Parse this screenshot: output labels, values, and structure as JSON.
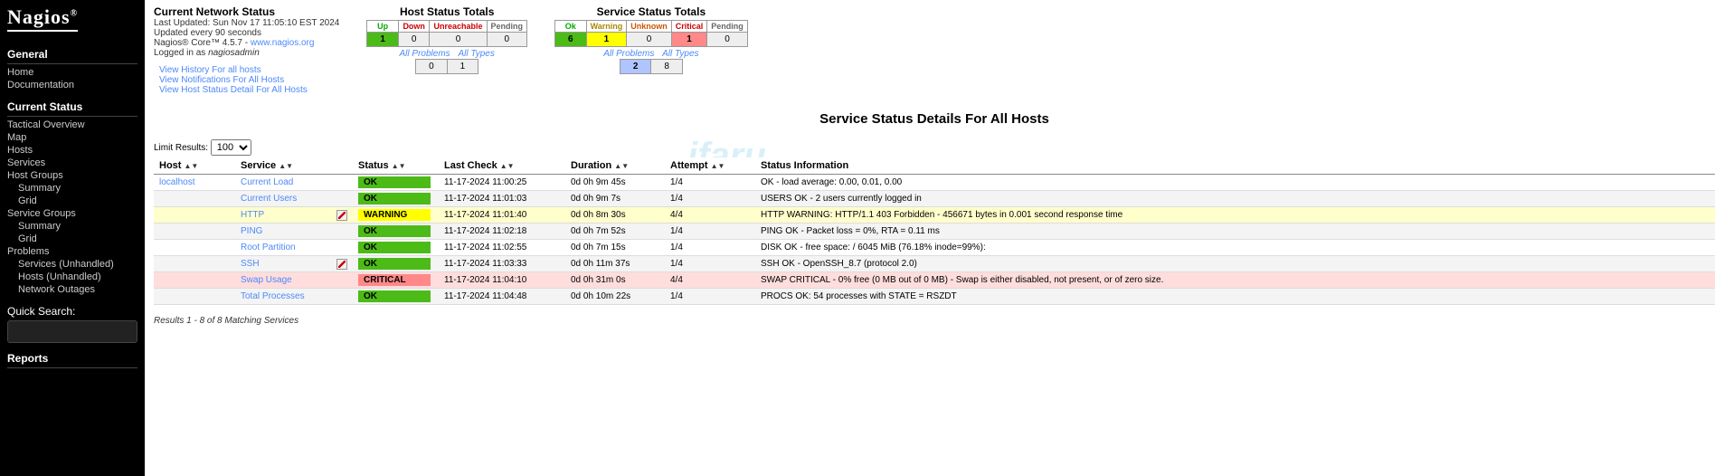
{
  "brand": "Nagios",
  "sidebar": {
    "sections": [
      {
        "title": "General",
        "items": [
          "Home",
          "Documentation"
        ]
      },
      {
        "title": "Current Status",
        "items": [
          "Tactical Overview",
          "Map",
          "Hosts",
          "Services",
          "Host Groups"
        ],
        "sub1": [
          "Summary",
          "Grid"
        ],
        "items2": [
          "Service Groups"
        ],
        "sub2": [
          "Summary",
          "Grid"
        ],
        "items3": [
          "Problems"
        ],
        "sub3": [
          "Services (Unhandled)",
          "Hosts (Unhandled)",
          "Network Outages"
        ]
      },
      {
        "title": "Reports",
        "items": []
      }
    ],
    "search_label": "Quick Search:"
  },
  "status_info": {
    "title": "Current Network Status",
    "last_updated": "Last Updated: Sun Nov 17 11:05:10 EST 2024",
    "updated_every": "Updated every 90 seconds",
    "core_prefix": "Nagios® Core™ 4.5.7 - ",
    "core_link": "www.nagios.org",
    "logged_in_prefix": "Logged in as ",
    "logged_in_user": "nagiosadmin",
    "links": [
      "View History For all hosts",
      "View Notifications For All Hosts",
      "View Host Status Detail For All Hosts"
    ]
  },
  "host_totals": {
    "title": "Host Status Totals",
    "headers": [
      "Up",
      "Down",
      "Unreachable",
      "Pending"
    ],
    "values": [
      "1",
      "0",
      "0",
      "0"
    ],
    "sub_labels": [
      "All Problems",
      "All Types"
    ],
    "sub_values": [
      "0",
      "1"
    ]
  },
  "service_totals": {
    "title": "Service Status Totals",
    "headers": [
      "Ok",
      "Warning",
      "Unknown",
      "Critical",
      "Pending"
    ],
    "values": [
      "6",
      "1",
      "0",
      "1",
      "0"
    ],
    "sub_labels": [
      "All Problems",
      "All Types"
    ],
    "sub_values": [
      "2",
      "8"
    ]
  },
  "page_heading": "Service Status Details For All Hosts",
  "limit": {
    "label": "Limit Results:",
    "value": "100"
  },
  "columns": [
    "Host",
    "Service",
    "Status",
    "Last Check",
    "Duration",
    "Attempt",
    "Status Information"
  ],
  "rows": [
    {
      "host": "localhost",
      "service": "Current Load",
      "status": "OK",
      "last_check": "11-17-2024 11:00:25",
      "duration": "0d 0h 9m 45s",
      "attempt": "1/4",
      "info": "OK - load average: 0.00, 0.01, 0.00",
      "notify_off": false,
      "row_class": ""
    },
    {
      "host": "",
      "service": "Current Users",
      "status": "OK",
      "last_check": "11-17-2024 11:01:03",
      "duration": "0d 0h 9m 7s",
      "attempt": "1/4",
      "info": "USERS OK - 2 users currently logged in",
      "notify_off": false,
      "row_class": "row-alt"
    },
    {
      "host": "",
      "service": "HTTP",
      "status": "WARNING",
      "last_check": "11-17-2024 11:01:40",
      "duration": "0d 0h 8m 30s",
      "attempt": "4/4",
      "info": "HTTP WARNING: HTTP/1.1 403 Forbidden - 456671 bytes in 0.001 second response time",
      "notify_off": true,
      "row_class": "row-warn"
    },
    {
      "host": "",
      "service": "PING",
      "status": "OK",
      "last_check": "11-17-2024 11:02:18",
      "duration": "0d 0h 7m 52s",
      "attempt": "1/4",
      "info": "PING OK - Packet loss = 0%, RTA = 0.11 ms",
      "notify_off": false,
      "row_class": "row-alt"
    },
    {
      "host": "",
      "service": "Root Partition",
      "status": "OK",
      "last_check": "11-17-2024 11:02:55",
      "duration": "0d 0h 7m 15s",
      "attempt": "1/4",
      "info": "DISK OK - free space: / 6045 MiB (76.18% inode=99%):",
      "notify_off": false,
      "row_class": ""
    },
    {
      "host": "",
      "service": "SSH",
      "status": "OK",
      "last_check": "11-17-2024 11:03:33",
      "duration": "0d 0h 11m 37s",
      "attempt": "1/4",
      "info": "SSH OK - OpenSSH_8.7 (protocol 2.0)",
      "notify_off": true,
      "row_class": "row-alt"
    },
    {
      "host": "",
      "service": "Swap Usage",
      "status": "CRITICAL",
      "last_check": "11-17-2024 11:04:10",
      "duration": "0d 0h 31m 0s",
      "attempt": "4/4",
      "info": "SWAP CRITICAL - 0% free (0 MB out of 0 MB) - Swap is either disabled, not present, or of zero size.",
      "notify_off": false,
      "row_class": "row-crit"
    },
    {
      "host": "",
      "service": "Total Processes",
      "status": "OK",
      "last_check": "11-17-2024 11:04:48",
      "duration": "0d 0h 10m 22s",
      "attempt": "1/4",
      "info": "PROCS OK: 54 processes with STATE = RSZDT",
      "notify_off": false,
      "row_class": "row-alt"
    }
  ],
  "results_line": "Results 1 - 8 of 8 Matching Services"
}
